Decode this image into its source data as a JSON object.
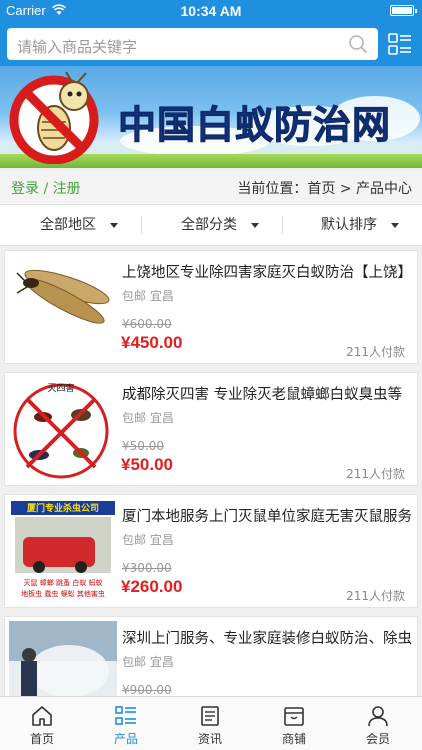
{
  "status_bar": {
    "carrier": "Carrier",
    "time": "10:34 AM"
  },
  "search": {
    "placeholder": "请输入商品关键字"
  },
  "banner": {
    "title": "中国白蚁防治网"
  },
  "breadcrumb_bar": {
    "login": "登录 / 注册",
    "location": "当前位置：首页 > 产品中心"
  },
  "filters": {
    "region": "全部地区",
    "category": "全部分类",
    "sort": "默认排序"
  },
  "products": [
    {
      "name": "上饶地区专业除四害家庭灭白蚁防治【上饶】",
      "tag": "包邮  宜昌",
      "old_price": "¥600.00",
      "price": "¥450.00",
      "sold": "211人付款"
    },
    {
      "name": "成都除灭四害 专业除灭老鼠蟑螂白蚁臭虫等",
      "tag": "包邮  宜昌",
      "old_price": "¥50.00",
      "price": "¥50.00",
      "sold": "211人付款",
      "thumb_text": "灭四害"
    },
    {
      "name": "厦门本地服务上门灭鼠单位家庭无害灭鼠服务",
      "tag": "包邮  宜昌",
      "old_price": "¥300.00",
      "price": "¥260.00",
      "sold": "211人付款",
      "thumb_header": "厦门专业杀虫公司",
      "thumb_footer_1": "灭鼠 蟑螂 跳蚤 白蚁 蚂蚁",
      "thumb_footer_2": "地板虫 蠹虫 蜈蚣 其他害虫"
    },
    {
      "name": "深圳上门服务、专业家庭装修白蚁防治、除虫",
      "tag": "包邮  宜昌",
      "old_price": "¥900.00",
      "price": "",
      "sold": ""
    }
  ],
  "tabbar": [
    {
      "label": "首页",
      "icon": "home-icon"
    },
    {
      "label": "产品",
      "icon": "list-icon"
    },
    {
      "label": "资讯",
      "icon": "news-icon"
    },
    {
      "label": "商铺",
      "icon": "store-icon"
    },
    {
      "label": "会员",
      "icon": "user-icon"
    }
  ],
  "colors": {
    "brand_blue": "#1f8fe0",
    "price_red": "#e02020",
    "login_green": "#43a33e"
  }
}
